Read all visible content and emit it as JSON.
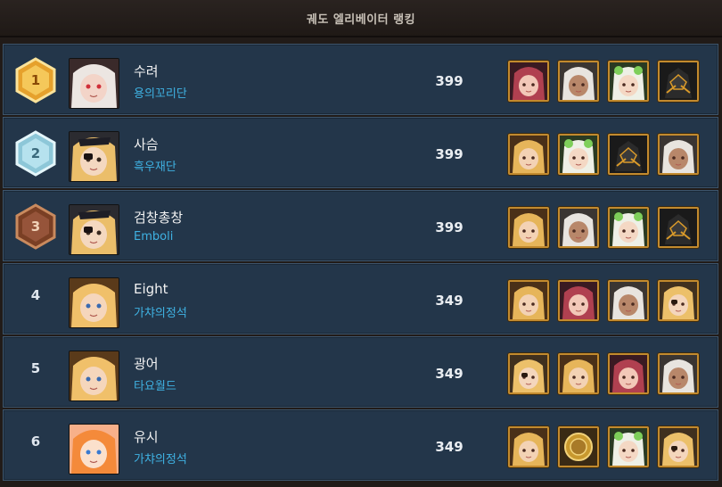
{
  "header": {
    "title": "궤도 엘리베이터 랭킹"
  },
  "colors": {
    "gold": "#e7a531",
    "silver": "#9fd3e2",
    "bronze": "#8a4b2c",
    "row_bg": "#23364a",
    "guild_text": "#3fb2e3",
    "frame": "#c28a2e"
  },
  "rows": [
    {
      "rank": "1",
      "medal": "gold",
      "avatar": "white-hair-red-eye-girl-avatar",
      "name": "수려",
      "guild": "용의꼬리단",
      "score": "399",
      "party": [
        "red-hair-hero-icon",
        "white-hair-hero-icon",
        "green-flower-hero-icon",
        "black-armor-hero-icon"
      ]
    },
    {
      "rank": "2",
      "medal": "silver",
      "avatar": "eyepatch-blonde-girl-avatar",
      "name": "사슴",
      "guild": "흑우재단",
      "score": "399",
      "party": [
        "blonde-hero-icon",
        "green-flower-hero-icon",
        "black-armor-hero-icon",
        "white-hair-hero-icon"
      ]
    },
    {
      "rank": "3",
      "medal": "bronze",
      "avatar": "eyepatch-blonde-girl-avatar",
      "name": "검창총창",
      "guild": "Emboli",
      "score": "399",
      "party": [
        "blonde-hero-icon",
        "white-hair-hero-icon",
        "green-flower-hero-icon",
        "black-armor-hero-icon"
      ]
    },
    {
      "rank": "4",
      "medal": "none",
      "avatar": "blonde-girl-avatar",
      "name": "Eight",
      "guild": "가챠의정석",
      "score": "349",
      "party": [
        "blonde-hero-icon",
        "red-hair-hero-icon",
        "white-hair-hero-icon",
        "eyepatch-hero-icon"
      ]
    },
    {
      "rank": "5",
      "medal": "none",
      "avatar": "blonde-girl-avatar",
      "name": "광어",
      "guild": "타요월드",
      "score": "349",
      "party": [
        "eyepatch-hero-icon",
        "blonde-hero-icon",
        "red-hair-hero-icon",
        "white-hair-hero-icon"
      ]
    },
    {
      "rank": "6",
      "medal": "none",
      "avatar": "orange-hair-wink-girl-avatar",
      "name": "유시",
      "guild": "가챠의정석",
      "score": "349",
      "party": [
        "blonde-hero-icon",
        "gold-coin-hero-icon",
        "green-flower-hero-icon",
        "eyepatch-hero-icon"
      ]
    }
  ]
}
